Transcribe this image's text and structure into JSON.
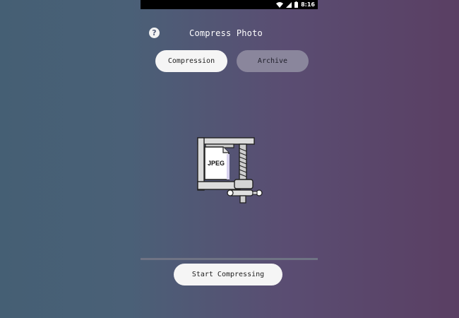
{
  "status_bar": {
    "time": "8:16",
    "icons": [
      "wifi-icon",
      "signal-icon",
      "battery-icon"
    ]
  },
  "header": {
    "title": "Compress Photo",
    "help_icon": "?"
  },
  "tabs": [
    {
      "label": "Compression",
      "selected": true
    },
    {
      "label": "Archive",
      "selected": false
    }
  ],
  "illustration": {
    "icon": "clamp-compress-icon",
    "file_label": "JPEG"
  },
  "actions": {
    "start_label": "Start Compressing"
  },
  "colors": {
    "status_bar": "#000000",
    "button_light": "#f5f5f5",
    "tab_inactive": "#8a869c",
    "divider": "#6f7384",
    "text_white": "#ffffff"
  }
}
